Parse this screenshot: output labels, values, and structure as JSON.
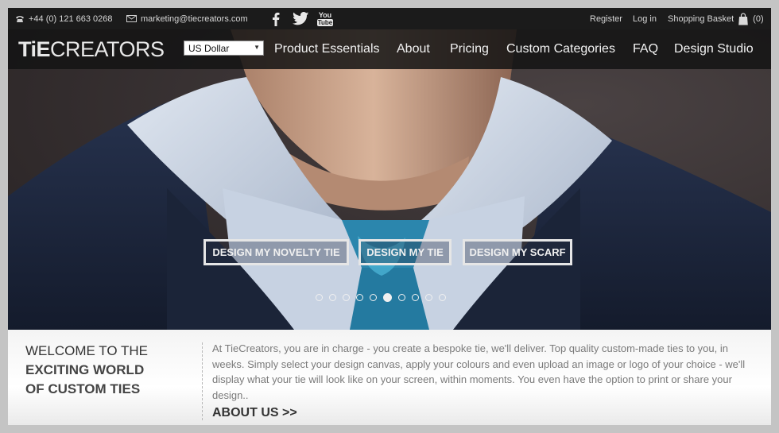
{
  "topbar": {
    "phone": "+44 (0) 121 663 0268",
    "email": "marketing@tiecreators.com",
    "social_icons": [
      "facebook-icon",
      "twitter-icon",
      "youtube-icon"
    ],
    "youtube_text_top": "You",
    "youtube_text_bottom": "Tube",
    "register": "Register",
    "login": "Log in",
    "basket_label": "Shopping Basket",
    "basket_count": "(0)"
  },
  "navbar": {
    "logo_bold": "TiE",
    "logo_rest": "CREATORS",
    "currency": "US Dollar",
    "items": [
      "Product Essentials",
      "About",
      "Pricing",
      "Custom Categories",
      "FAQ",
      "Design Studio"
    ]
  },
  "hero": {
    "buttons": [
      "DESIGN MY NOVELTY TIE",
      "DESIGN MY TIE",
      "DESIGN MY SCARF"
    ],
    "slide_count": 10,
    "active_slide": 6
  },
  "welcome": {
    "line1": "WELCOME TO THE",
    "line2": "EXCITING WORLD",
    "line3": "OF CUSTOM TIES",
    "body": "At TieCreators, you are in charge - you create a bespoke tie, we'll deliver. Top quality custom-made ties to you, in weeks. Simply select your design canvas, apply your colours and even upload an image or logo of your choice - we'll display what your tie will look like on your screen, within moments. You even have the option to print or share your design..",
    "about_link": "ABOUT US >>"
  },
  "colors": {
    "topbar_bg": "#1b1b1b",
    "navbar_bg": "#141414",
    "suit": "#1f2a44",
    "shirt": "#c9d3e3",
    "tie": "#2e8fb3",
    "backdrop": "#3b3536"
  }
}
